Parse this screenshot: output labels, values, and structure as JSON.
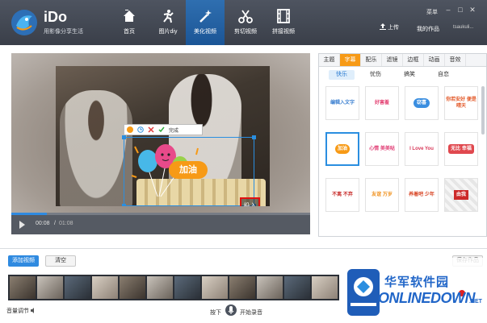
{
  "app": {
    "title": "iDo",
    "subtitle": "用影像分享生活"
  },
  "nav": [
    {
      "label": "首页",
      "icon": "home-icon"
    },
    {
      "label": "图片diy",
      "icon": "dancer-icon"
    },
    {
      "label": "美化视频",
      "icon": "magic-wand-icon"
    },
    {
      "label": "剪切视频",
      "icon": "scissors-icon"
    },
    {
      "label": "拼接视频",
      "icon": "film-icon"
    }
  ],
  "nav_active": "美化视频",
  "header": {
    "menu": "菜单",
    "upload": "上传",
    "my_works": "我的作品",
    "username": "tsaukuli..."
  },
  "player": {
    "current_time": "00:08",
    "separator": "/",
    "total_time": "01:08",
    "progress_fraction": 0.12
  },
  "overlay": {
    "done_label": "完成",
    "sticker_text": "加油",
    "corner_text": "投入"
  },
  "panel": {
    "tabs": [
      "主题",
      "字幕",
      "配乐",
      "滤镜",
      "边框",
      "动画",
      "音效"
    ],
    "active_tab": "字幕",
    "subtabs": [
      "快乐",
      "忧伤",
      "搞笑",
      "自恋"
    ],
    "active_subtab": "快乐",
    "stickers": [
      {
        "label": "编辑入文字",
        "color": "#3a7fd0"
      },
      {
        "label": "好害羞",
        "color": "#e23a6d"
      },
      {
        "label": "窃喜",
        "color": "#3a8ee0"
      },
      {
        "label": "你若安好 便是晴天",
        "color": "#e35a2a"
      },
      {
        "label": "加油",
        "color": "#f79a16"
      },
      {
        "label": "心情 美美哒",
        "color": "#e2457a"
      },
      {
        "label": "I Love You",
        "color": "#d83a5a"
      },
      {
        "label": "无比 幸福",
        "color": "#e0484e"
      },
      {
        "label": "不离 不弃",
        "color": "#c8302e"
      },
      {
        "label": "友谊 万岁",
        "color": "#f0901c"
      },
      {
        "label": "养着吧 少年",
        "color": "#d94a2a"
      },
      {
        "label": "由我",
        "color": "#cc2a2a"
      }
    ]
  },
  "bottom": {
    "add_video": "添加视频",
    "clear": "清空",
    "save": "保存作品",
    "volume_label": "音量调节",
    "press_label": "按下",
    "record_label": "开始录音"
  },
  "watermark": {
    "cn": "华军软件园",
    "en": "ONLINEDOWN",
    "suffix": ".NET"
  },
  "colors": {
    "accent_orange": "#f79a16",
    "accent_blue": "#2f8ae0",
    "header_dark": "#3e444e"
  }
}
